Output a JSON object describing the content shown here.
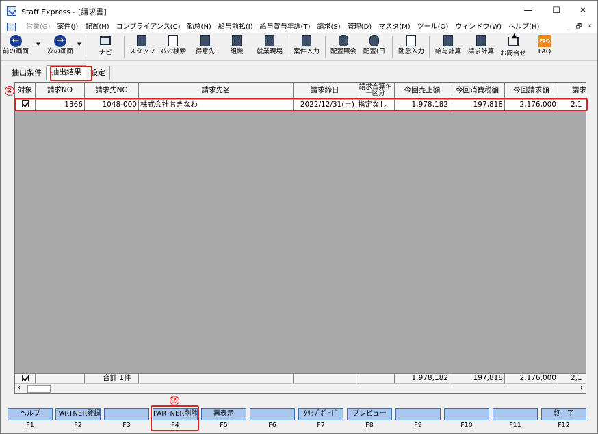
{
  "window": {
    "title": "Staff Express - [請求書]",
    "minimize": "—",
    "maximize": "☐",
    "close": "✕"
  },
  "menu": [
    {
      "label": "営業(G)",
      "disabled": true
    },
    {
      "label": "案件(J)"
    },
    {
      "label": "配置(H)"
    },
    {
      "label": "コンプライアンス(C)"
    },
    {
      "label": "勤怠(N)"
    },
    {
      "label": "給与前払(I)"
    },
    {
      "label": "給与賞与年調(T)"
    },
    {
      "label": "請求(S)"
    },
    {
      "label": "管理(D)"
    },
    {
      "label": "マスタ(M)"
    },
    {
      "label": "ツール(O)"
    },
    {
      "label": "ウィンドウ(W)"
    },
    {
      "label": "ヘルプ(H)"
    }
  ],
  "mdi_controls": [
    "_",
    "🗗",
    "✕"
  ],
  "toolbar": {
    "prev": "前の画面",
    "next": "次の画面",
    "navi": "ナビ",
    "staff": "スタッフ",
    "staff_search": "ｽﾀｯﾌ検索",
    "client": "得意先",
    "org": "組織",
    "worksite": "就業現場",
    "case_entry": "案件入力",
    "assign_view": "配置照会",
    "assign_day": "配置(日",
    "attend_entry": "勤怠入力",
    "pay_calc": "給与計算",
    "bill_calc": "請求計算",
    "inquiry": "お問合せ",
    "faq": "FAQ",
    "faq_icon_text": "FAQ"
  },
  "tabs": [
    "抽出条件",
    "抽出結果",
    "設定"
  ],
  "markers": [
    "②",
    "②"
  ],
  "grid": {
    "headers": [
      "対象",
      "請求NO",
      "請求先NO",
      "請求先名",
      "請求締日",
      "請求合算キー区分",
      "今回売上額",
      "今回消費税額",
      "今回請求額",
      "請求"
    ],
    "row": {
      "target": "",
      "bill_no": "1366",
      "client_no": "1048-000",
      "client_name": "株式会社おきなわ",
      "close_date": "2022/12/31(土)",
      "merge_key": "指定なし",
      "sales": "1,978,182",
      "tax": "197,818",
      "billing": "2,176,000",
      "more": "2,1"
    },
    "summary": {
      "label": "合計 1件",
      "sales": "1,978,182",
      "tax": "197,818",
      "billing": "2,176,000",
      "more": "2,1"
    }
  },
  "fkeys": [
    {
      "label": "ヘルプ",
      "key": "F1"
    },
    {
      "label": "PARTNER登録",
      "key": "F2"
    },
    {
      "label": "",
      "key": "F3"
    },
    {
      "label": "PARTNER削除",
      "key": "F4"
    },
    {
      "label": "再表示",
      "key": "F5"
    },
    {
      "label": "",
      "key": "F6"
    },
    {
      "label": "ｸﾘｯﾌﾟﾎﾞｰﾄﾞ",
      "key": "F7"
    },
    {
      "label": "プレビュー",
      "key": "F8"
    },
    {
      "label": "",
      "key": "F9"
    },
    {
      "label": "",
      "key": "F10"
    },
    {
      "label": "",
      "key": "F11"
    },
    {
      "label": "終　了",
      "key": "F12"
    }
  ],
  "colors": {
    "accent_red": "#e02020",
    "fkey_bg": "#a8c8f0",
    "grid_bg": "#a9a9a9"
  }
}
